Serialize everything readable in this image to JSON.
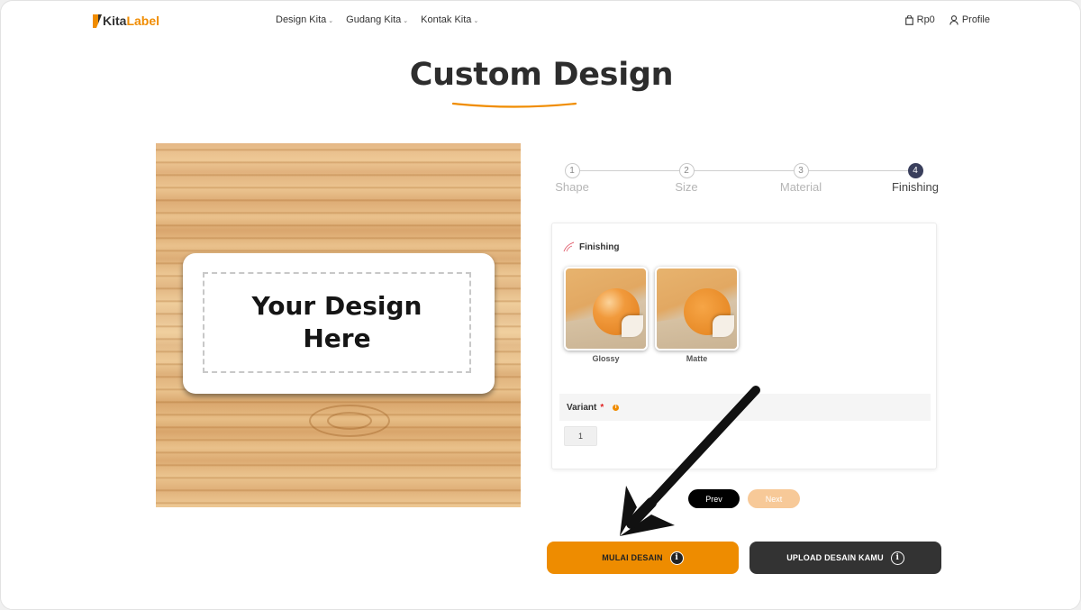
{
  "header": {
    "logo_a": "Kita",
    "logo_b": "Label",
    "nav": [
      {
        "label": "Design Kita"
      },
      {
        "label": "Gudang Kita"
      },
      {
        "label": "Kontak Kita"
      }
    ],
    "cart_amount": "Rp0",
    "profile_label": "Profile"
  },
  "title": "Custom Design",
  "preview": {
    "line1": "Your Design",
    "line2": "Here"
  },
  "stepper": {
    "steps": [
      {
        "num": "1",
        "label": "Shape"
      },
      {
        "num": "2",
        "label": "Size"
      },
      {
        "num": "3",
        "label": "Material"
      },
      {
        "num": "4",
        "label": "Finishing"
      }
    ],
    "active_step": 4
  },
  "finishing": {
    "title": "Finishing",
    "options": [
      {
        "label": "Glossy"
      },
      {
        "label": "Matte"
      }
    ],
    "variant_label": "Variant",
    "variant_required": "*",
    "variant_value": "1"
  },
  "nav_buttons": {
    "prev": "Prev",
    "next": "Next"
  },
  "actions": {
    "start_label": "MULAI DESAIN",
    "upload_label": "UPLOAD DESAIN KAMU"
  },
  "colors": {
    "accent": "#ee8c00",
    "dark": "#333333",
    "step_active": "#3a3f5c"
  }
}
